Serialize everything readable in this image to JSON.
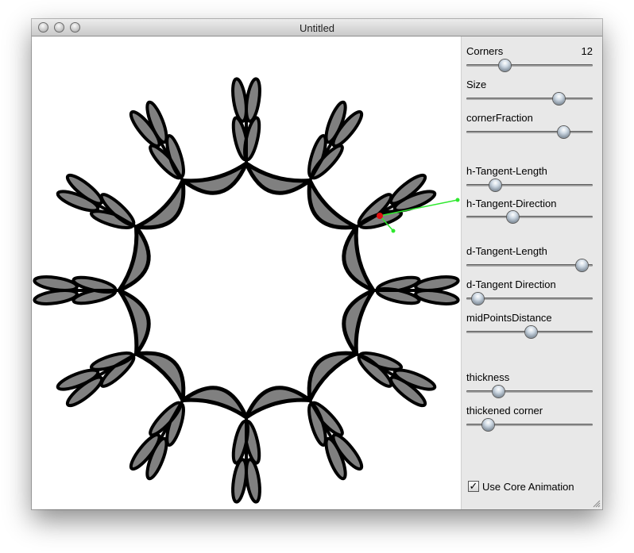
{
  "window": {
    "title": "Untitled"
  },
  "controls": {
    "corners": {
      "label": "Corners",
      "value": "12",
      "level": 0.28
    },
    "size": {
      "label": "Size",
      "level": 0.75
    },
    "corner_fraction": {
      "label": "cornerFraction",
      "level": 0.79
    },
    "h_tangent_length": {
      "label": "h-Tangent-Length",
      "level": 0.2
    },
    "h_tangent_direction": {
      "label": "h-Tangent-Direction",
      "level": 0.35
    },
    "d_tangent_length": {
      "label": "d-Tangent-Length",
      "level": 0.95
    },
    "d_tangent_direction": {
      "label": "d-Tangent Direction",
      "level": 0.05
    },
    "mid_points_distance": {
      "label": "midPointsDistance",
      "level": 0.51
    },
    "thickness": {
      "label": "thickness",
      "level": 0.23
    },
    "thickened_corner": {
      "label": "thickened corner",
      "level": 0.14
    },
    "use_core_animation": {
      "label": "Use Core Animation",
      "checked": true
    }
  },
  "shape": {
    "fill": "#808080",
    "stroke": "#000000",
    "handle_color": "#2ee82e",
    "point_color": "#e01010"
  }
}
